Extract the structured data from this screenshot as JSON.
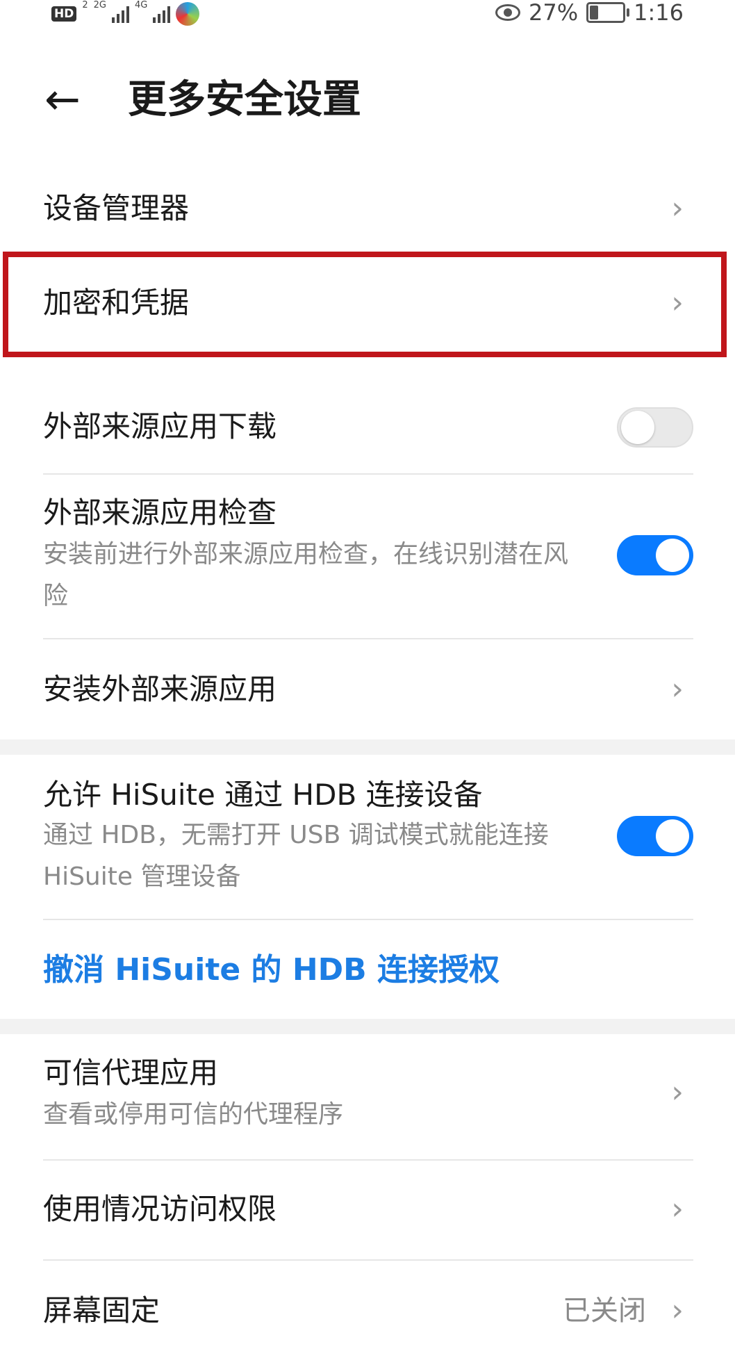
{
  "status_bar": {
    "hd": "HD",
    "hd_sub": "2",
    "net1": "2G",
    "net2": "4G",
    "battery_percent": "27%",
    "time": "1:16",
    "battery_level": 0.27
  },
  "header": {
    "back_glyph": "←",
    "title": "更多安全设置"
  },
  "items": {
    "device_manager": {
      "label": "设备管理器"
    },
    "encryption": {
      "label": "加密和凭据"
    },
    "external_download": {
      "label": "外部来源应用下载",
      "toggle": "off"
    },
    "external_check": {
      "label": "外部来源应用检查",
      "sub": "安装前进行外部来源应用检查，在线识别潜在风险",
      "toggle": "on"
    },
    "install_external": {
      "label": "安装外部来源应用"
    },
    "hisuite_hdb": {
      "label": "允许 HiSuite 通过 HDB 连接设备",
      "sub": "通过 HDB，无需打开 USB 调试模式就能连接 HiSuite 管理设备",
      "toggle": "on"
    },
    "revoke_hdb": {
      "label": "撤消 HiSuite 的 HDB 连接授权"
    },
    "trusted_agents": {
      "label": "可信代理应用",
      "sub": "查看或停用可信的代理程序"
    },
    "usage_access": {
      "label": "使用情况访问权限"
    },
    "screen_pinning": {
      "label": "屏幕固定",
      "value": "已关闭"
    }
  },
  "chevron": "›",
  "colors": {
    "accent": "#0a7bff",
    "link": "#1c7de3",
    "highlight": "#c0161b"
  }
}
